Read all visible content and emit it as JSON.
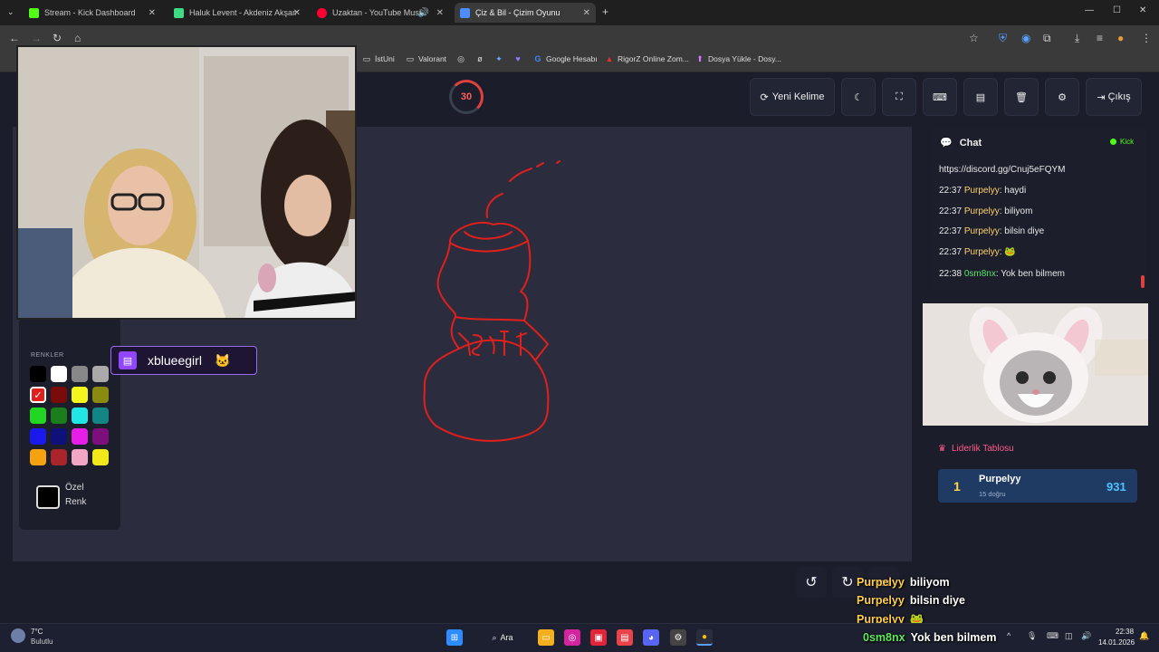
{
  "browser": {
    "tabs": [
      {
        "label": "Stream - Kick Dashboard",
        "color": "#53fc18",
        "active": false
      },
      {
        "label": "Haluk Levent - Akdeniz Akşamları",
        "color": "#3ddc84",
        "active": false
      },
      {
        "label": "Uzaktan - YouTube Music",
        "color": "#ff0033",
        "active": false
      },
      {
        "label": "Çiz & Bil - Çizim Oyunu",
        "color": "#4d8dff",
        "active": true
      }
    ],
    "bookmarks": [
      "İstUni",
      "Valorant",
      "Google Hesabı",
      "RigorZ Online Zom...",
      "Dosya Yükle - Dosy..."
    ]
  },
  "game": {
    "timer": "30",
    "new_word_label": "Yeni Kelime",
    "exit_label": "Çıkış",
    "colors_label": "RENKLER",
    "custom_color_label_1": "Özel",
    "custom_color_label_2": "Renk",
    "palette": [
      "#000000",
      "#ffffff",
      "#888888",
      "#aaaaaa",
      "#e0201c",
      "#7a0b0b",
      "#f5f51e",
      "#8a8a10",
      "#22d722",
      "#1b7d1b",
      "#22e6e6",
      "#138585",
      "#1a1aee",
      "#10107a",
      "#e81de8",
      "#7d0f7d",
      "#f5a210",
      "#a8262b",
      "#f2a6c4",
      "#f2e81a"
    ],
    "selected_color": "#e0201c"
  },
  "overlay": {
    "twitch_name": "xblueegirl"
  },
  "chat": {
    "title": "Chat",
    "platform": "Kick",
    "link": "https://discord.gg/Cnuj5eFQYM",
    "messages": [
      {
        "time": "22:37",
        "user": "Purpelyy",
        "text": ": haydi"
      },
      {
        "time": "22:37",
        "user": "Purpelyy",
        "text": ": biliyom"
      },
      {
        "time": "22:37",
        "user": "Purpelyy",
        "text": ": bilsin diye"
      },
      {
        "time": "22:37",
        "user": "Purpelyy",
        "text": ": 🐸"
      },
      {
        "time": "22:38",
        "user": "0sm8nx",
        "text": ": Yok ben bilmem"
      }
    ]
  },
  "leaderboard": {
    "title": "Liderlik Tablosu",
    "rank": "1",
    "name": "Purpelyy",
    "sub": "15 doğru",
    "score": "931"
  },
  "stream_overlay": [
    {
      "user": "Purpelyy",
      "text": "biliyom"
    },
    {
      "user": "Purpelyy",
      "text": "bilsin diye"
    },
    {
      "user": "Purpelyy",
      "text": "🐸"
    },
    {
      "user": "0sm8nx",
      "text": "Yok ben bilmem"
    }
  ],
  "taskbar": {
    "temperature": "7°C",
    "weather": "Bulutlu",
    "search": "Ara",
    "time": "22:38",
    "date": "14.01.2026"
  }
}
